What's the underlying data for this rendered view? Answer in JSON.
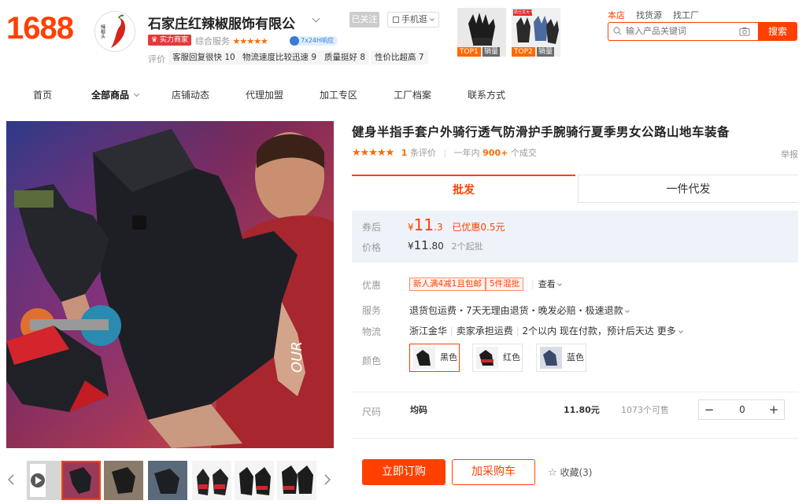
{
  "header": {
    "logo": "1688",
    "shop_name": "石家庄红辣椒服饰有限公",
    "avatar_text": "辣椒头",
    "follow_label": "已关注",
    "mobile_label": "手机逛",
    "badge_strength": "实力商家",
    "service_label": "综合服务",
    "service_stars": "★★★★★",
    "response_badge": "7x24H响应",
    "rating_label": "评价",
    "ratings": [
      {
        "label": "客服回复很快",
        "count": "10"
      },
      {
        "label": "物流速度比较迅速",
        "count": "9"
      },
      {
        "label": "质量挺好",
        "count": "8"
      },
      {
        "label": "性价比超高",
        "count": "7"
      }
    ],
    "top_items": [
      {
        "tag": "TOP1",
        "sub": "销量",
        "top_text": ""
      },
      {
        "tag": "TOP2",
        "sub": "销量",
        "top_text": "凯仕龙大卡"
      }
    ]
  },
  "search": {
    "tabs": [
      "本店",
      "找货源",
      "找工厂"
    ],
    "placeholder": "输入产品关键词",
    "button": "搜索"
  },
  "nav": {
    "items": [
      "首页",
      "全部商品",
      "店铺动态",
      "代理加盟",
      "加工专区",
      "工厂档案",
      "联系方式"
    ]
  },
  "gallery": {
    "watermark": "OUR"
  },
  "product": {
    "title": "健身半指手套户外骑行透气防滑护手腕骑行夏季男女公路山地车装备",
    "stars": "★★★★★",
    "review_count": "1",
    "review_label": "条评价",
    "period_label": "一年内",
    "sold_count": "900+",
    "sold_label": "个成交",
    "report_label": "举报"
  },
  "tabs": {
    "wholesale": "批发",
    "dropship": "一件代发"
  },
  "pricing": {
    "after_coupon_label": "券后",
    "after_coupon_currency": "¥",
    "after_coupon_int": "11",
    "after_coupon_dec": ".3",
    "discount_text": "已优惠0.5元",
    "price_label": "价格",
    "price_currency": "¥",
    "price_int": "11",
    "price_dec": ".80",
    "min_order": "2个起批"
  },
  "details": {
    "promo_label": "优惠",
    "promos": [
      "新人满4减1且包邮",
      "5件混批"
    ],
    "view_more": "查看",
    "service_label": "服务",
    "service_value": "退货包运费・7天无理由退货・晚发必赔・极速退款",
    "logistics_label": "物流",
    "origin": "浙江金华",
    "freight": "卖家承担运费",
    "delivery": "2个以内",
    "delivery_note": "现在付款，预计后天达",
    "more": "更多",
    "color_label": "颜色",
    "colors": [
      "黑色",
      "红色",
      "蓝色"
    ]
  },
  "sku": {
    "size_label": "尺码",
    "size": "均码",
    "price": "11.80元",
    "stock": "1073个可售",
    "minus": "−",
    "quantity": "0",
    "plus": "+"
  },
  "actions": {
    "buy_now": "立即订购",
    "add_to_cart": "加采购车",
    "favorite": "收藏(3)"
  },
  "colors": {
    "accent": "#ff4000",
    "price_panel": "#eef3f9"
  }
}
